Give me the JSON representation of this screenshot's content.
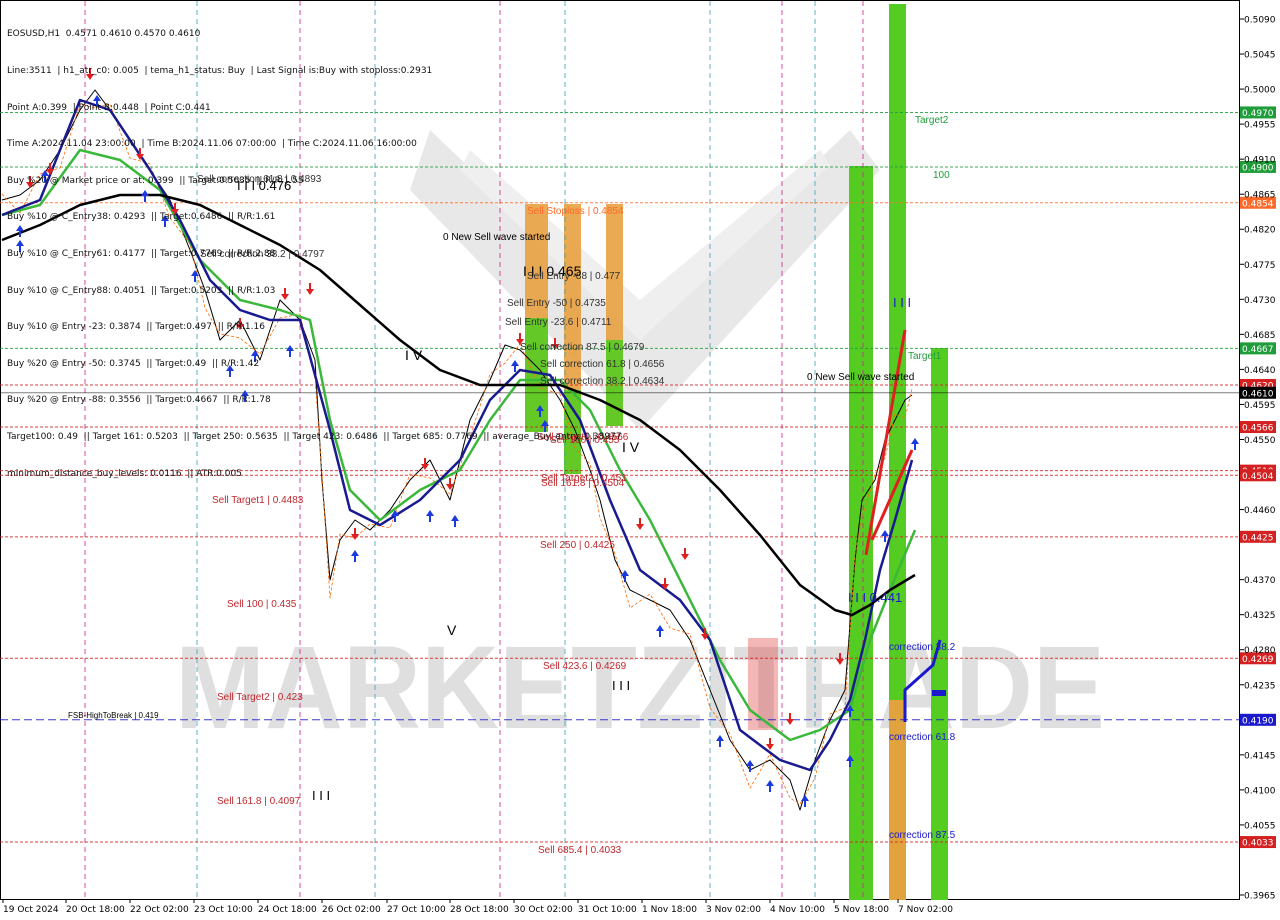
{
  "header": {
    "lines": [
      "EOSUSD,H1  0.4571 0.4610 0.4570 0.4610",
      "Line:3511  | h1_atr_c0: 0.005  | tema_h1_status: Buy  | Last Signal is:Buy with stoploss:0.2931",
      "Point A:0.399  | Point B:0.448  | Point C:0.441",
      "Time A:2024.11.04 23:00:00  | Time B:2024.11.06 07:00:00  | Time C:2024.11.06 16:00:00",
      "Buy %20 @ Market price or at: 0.399  || Target:0.5635  || R/R:1.55",
      "Buy %10 @ C_Entry38: 0.4293  || Target:0.6486  || R/R:1.61",
      "Buy %10 @ C_Entry61: 0.4177  || Target:0.7769  || R/R:2.88",
      "Buy %10 @ C_Entry88: 0.4051  || Target:0.5203  || R/R:1.03",
      "Buy %10 @ Entry -23: 0.3874  || Target:0.497  || R/R:1.16",
      "Buy %20 @ Entry -50: 0.3745  || Target:0.49  || R/R:1.42",
      "Buy %20 @ Entry -88: 0.3556  || Target:0.4667  || R/R:1.78",
      "Target100: 0.49  || Target 161: 0.5203  || Target 250: 0.5635  || Target 423: 0.6486  || Target 685: 0.7769  || average_Buy_entry: 0.38977",
      "minimum_distance_buy_levels: 0.0116  || ATR:0.005"
    ]
  },
  "chart_data": {
    "type": "line",
    "symbol": "EOSUSD",
    "timeframe": "H1",
    "ylim": [
      0.3965,
      0.509
    ],
    "y_ticks": [
      "0.5090",
      "0.5045",
      "0.5000",
      "0.4955",
      "0.4910",
      "0.4865",
      "0.4820",
      "0.4775",
      "0.4730",
      "0.4685",
      "0.4640",
      "0.4595",
      "0.4550",
      "0.4460",
      "0.4370",
      "0.4325",
      "0.4280",
      "0.4235",
      "0.4145",
      "0.4100",
      "0.4055",
      "0.3965"
    ],
    "x_labels": [
      "19 Oct 2024",
      "20 Oct 18:00",
      "22 Oct 02:00",
      "23 Oct 10:00",
      "24 Oct 18:00",
      "26 Oct 02:00",
      "27 Oct 10:00",
      "28 Oct 18:00",
      "30 Oct 02:00",
      "31 Oct 10:00",
      "1 Nov 18:00",
      "3 Nov 02:00",
      "4 Nov 10:00",
      "5 Nov 18:00",
      "7 Nov 02:00"
    ],
    "tagged_levels": [
      {
        "value": 0.497,
        "label": "0.4970",
        "color": "#1f9d3a"
      },
      {
        "value": 0.49,
        "label": "0.4900",
        "color": "#1f9d3a"
      },
      {
        "value": 0.4854,
        "label": "0.4854",
        "color": "#ff6a2a"
      },
      {
        "value": 0.4667,
        "label": "0.4667",
        "color": "#1f9d3a"
      },
      {
        "value": 0.462,
        "label": "0.4620",
        "color": "#d42020"
      },
      {
        "value": 0.461,
        "label": "0.4610",
        "color": "#000000"
      },
      {
        "value": 0.4566,
        "label": "0.4566",
        "color": "#d42020"
      },
      {
        "value": 0.451,
        "label": "0.4510",
        "color": "#d42020"
      },
      {
        "value": 0.4504,
        "label": "0.4504",
        "color": "#d42020"
      },
      {
        "value": 0.4425,
        "label": "0.4425",
        "color": "#d42020"
      },
      {
        "value": 0.4269,
        "label": "0.4269",
        "color": "#d42020"
      },
      {
        "value": 0.419,
        "label": "0.4190",
        "color": "#1a1acc"
      },
      {
        "value": 0.4033,
        "label": "0.4033",
        "color": "#d42020"
      }
    ],
    "annotations": [
      {
        "text": "Target2",
        "color": "#1f9d3a"
      },
      {
        "text": "100",
        "color": "#1f9d3a"
      },
      {
        "text": "Target1",
        "color": "#1f9d3a"
      },
      {
        "text": "0 New Sell wave started",
        "color": "#000000"
      },
      {
        "text": "0 New Sell wave started",
        "color": "#000000"
      },
      {
        "text": "Sell correction 61.8 | 0.4893",
        "color": "#333333"
      },
      {
        "text": "I I I  0.476",
        "color": "#000000"
      },
      {
        "text": "Sell correction 38.2 | 0.4797",
        "color": "#333333"
      },
      {
        "text": "Sell Stoploss | 0.4854",
        "color": "#ff6a2a"
      },
      {
        "text": "I I I  0.465",
        "color": "#000000"
      },
      {
        "text": "Sell Entry -88 | 0.477",
        "color": "#333333"
      },
      {
        "text": "Sell Entry -50 | 0.4735",
        "color": "#333333"
      },
      {
        "text": "Sell Entry -23.6 | 0.4711",
        "color": "#333333"
      },
      {
        "text": "Sell correction 87.5 | 0.4679",
        "color": "#333333"
      },
      {
        "text": "Sell correction 61.8 | 0.4656",
        "color": "#333333"
      },
      {
        "text": "Sell correction 38.2 | 0.4634",
        "color": "#333333"
      },
      {
        "text": "Sell Target1 | 0.4566",
        "color": "#c0272d"
      },
      {
        "text": "Sell 100 | 0.455",
        "color": "#c0272d"
      },
      {
        "text": "Sell Target2 | 0.451",
        "color": "#c0272d"
      },
      {
        "text": "Sell 161.8 | 0.4504",
        "color": "#c0272d"
      },
      {
        "text": "Sell  250 | 0.4425",
        "color": "#c0272d"
      },
      {
        "text": "Sell  423.6 | 0.4269",
        "color": "#c0272d"
      },
      {
        "text": "Sell  685.4 | 0.4033",
        "color": "#c0272d"
      },
      {
        "text": "Sell Target1 | 0.4483",
        "color": "#c0272d"
      },
      {
        "text": "Sell 100 | 0.435",
        "color": "#c0272d"
      },
      {
        "text": "Sell Target2 | 0.423",
        "color": "#c0272d"
      },
      {
        "text": "Sell 161.8 | 0.4097",
        "color": "#c0272d"
      },
      {
        "text": "FSB-HighToBreak  |  0.419",
        "color": "#000000"
      },
      {
        "text": "I V",
        "color": "#000000"
      },
      {
        "text": "V",
        "color": "#000000"
      },
      {
        "text": "I I I",
        "color": "#000000"
      },
      {
        "text": "I I I",
        "color": "#000000"
      },
      {
        "text": "I V",
        "color": "#000000"
      },
      {
        "text": "I I I",
        "color": "#1a1acc"
      },
      {
        "text": "I I I  0.441",
        "color": "#1a1acc"
      },
      {
        "text": "correction 38.2",
        "color": "#1a1acc"
      },
      {
        "text": "correction 61.8",
        "color": "#1a1acc"
      },
      {
        "text": "correction 87.5",
        "color": "#1a1acc"
      }
    ],
    "watermark": "MARKETZITRADE"
  }
}
